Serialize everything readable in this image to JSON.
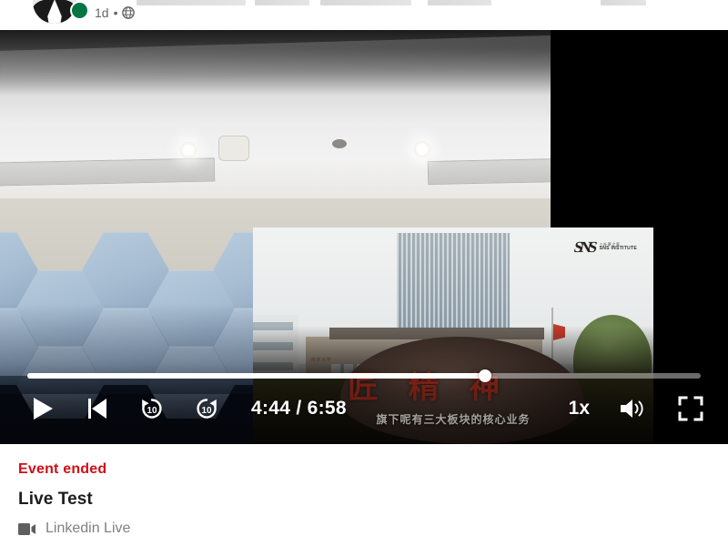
{
  "post_header": {
    "time_ago": "1d",
    "separator": "•",
    "visibility_icon": "globe-icon",
    "avatar_icon": "avatar",
    "live_status_icon": "live-status-dot"
  },
  "player": {
    "progress_percent": 68,
    "current_time": "4:44",
    "time_separator": "/",
    "total_time": "6:58",
    "time_display": "4:44 / 6:58",
    "speed_label": "1x",
    "controls": [
      {
        "name": "play-button",
        "icon": "play-icon"
      },
      {
        "name": "skip-to-start-button",
        "icon": "skip-previous-icon"
      },
      {
        "name": "rewind-10-button",
        "icon": "rewind-10-icon",
        "label": "10"
      },
      {
        "name": "forward-10-button",
        "icon": "forward-10-icon",
        "label": "10"
      },
      {
        "name": "playback-speed-button",
        "icon": "speed-icon",
        "label": "1x"
      },
      {
        "name": "volume-button",
        "icon": "volume-icon"
      },
      {
        "name": "fullscreen-button",
        "icon": "fullscreen-icon"
      }
    ]
  },
  "video_content": {
    "share_watermark_mark": "SNS",
    "share_watermark_cn": "三叶草之家",
    "share_watermark_en": "SNS INSTITUTE",
    "building_label": "南京大学",
    "calligraphy": "匠 精 神",
    "subtitle": "旗下呢有三大板块的核心业务"
  },
  "footer": {
    "status": "Event ended",
    "title": "Live Test",
    "type": "Linkedin Live",
    "type_icon": "video-camera-icon",
    "status_color": "#cc1016"
  }
}
